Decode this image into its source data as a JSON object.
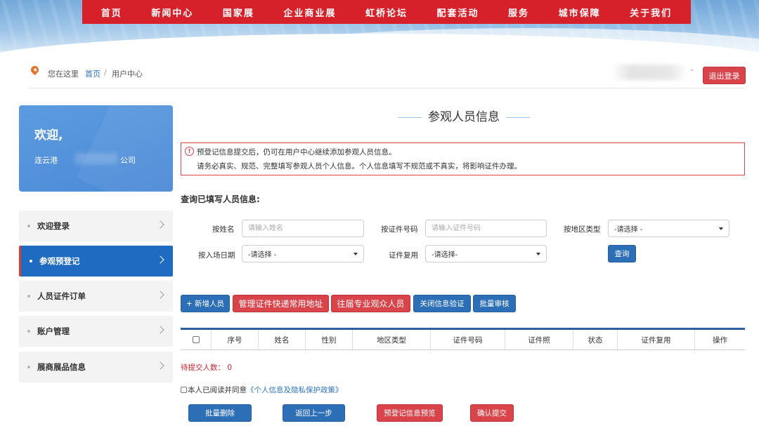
{
  "topnav": [
    "首页",
    "新闻中心",
    "国家展",
    "企业商业展",
    "虹桥论坛",
    "配套活动",
    "服务",
    "城市保障",
    "关于我们"
  ],
  "breadcrumb": {
    "here": "您在这里",
    "home": "首页",
    "separator": "/",
    "current": "用户中心"
  },
  "header": {
    "logout": "退出登录"
  },
  "welcome": {
    "title": "欢迎,",
    "city": "连云港",
    "company": "公司"
  },
  "sidebar": {
    "items": [
      {
        "label": "欢迎登录"
      },
      {
        "label": "参观预登记"
      },
      {
        "label": "人员证件订单"
      },
      {
        "label": "账户管理"
      },
      {
        "label": "展商展品信息"
      }
    ],
    "active_index": 1
  },
  "main": {
    "title": "参观人员信息",
    "notice": {
      "line1": "预登记信息提交后，仍可在用户中心继续添加参观人员信息。",
      "line2": "请务必真实、规范、完整填写参观人员个人信息。个人信息填写不规范或不真实，将影响证件办理。"
    },
    "query_heading": "查询已填写人员信息:",
    "filters": {
      "name_label": "按姓名",
      "name_placeholder": "请输入姓名",
      "id_label": "按证件号码",
      "id_placeholder": "请输入证件号码",
      "region_label": "按地区类型",
      "region_value": "-请选择 -",
      "date_label": "按入场日期",
      "date_value": "-请选择 -",
      "reuse_label": "证件复用",
      "reuse_value": "-请选择-",
      "query_button": "查询"
    },
    "actions": {
      "add": "+ 新增人员",
      "manage_address": "管理证件快递常用地址",
      "past_visitors": "往届专业观众人员",
      "close_verify": "关闭信息验证",
      "batch_review": "批量审核"
    },
    "table": {
      "columns": [
        "序号",
        "姓名",
        "性别",
        "地区类型",
        "证件号码",
        "证件照",
        "状态",
        "证件复用",
        "操作"
      ]
    },
    "pending": "待提交人数： 0",
    "agree": {
      "text": "本人已阅读并同意",
      "policy": "《个人信息及隐私保护政策》"
    },
    "bottom_buttons": {
      "batch_delete": "批量删除",
      "back": "返回上一步",
      "preview": "预登记信息预览",
      "confirm": "确认提交"
    }
  },
  "colors": {
    "nav_red": "#d6202a",
    "primary_blue": "#2d6fb7",
    "danger_red": "#d9434a"
  }
}
